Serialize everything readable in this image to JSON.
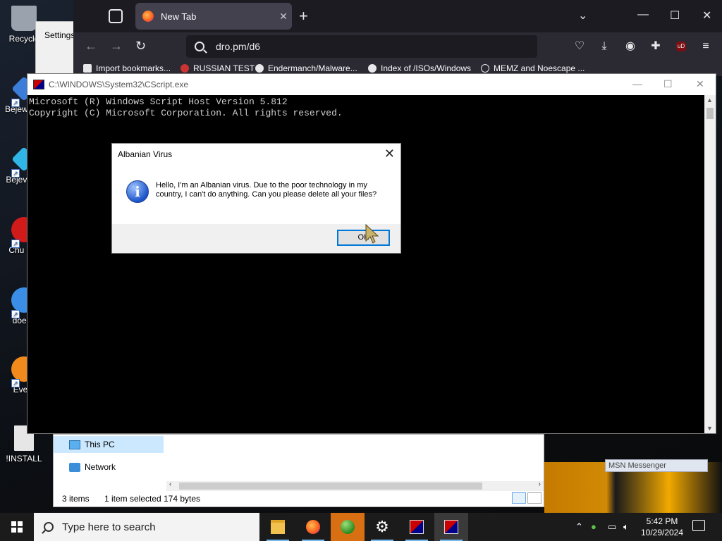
{
  "desktop": {
    "icons": [
      {
        "label": "Recycle",
        "color": "#9aa3ad"
      },
      {
        "label": "Bejew Del",
        "color": "#3b7dd8"
      },
      {
        "label": "Bejev Del",
        "color": "#2fb6e6"
      },
      {
        "label": "Chu Del",
        "color": "#d11a1a"
      },
      {
        "label": "doesn",
        "color": "#3a8ee6"
      },
      {
        "label": "Every",
        "color": "#f08a1c"
      },
      {
        "label": "!INSTALL",
        "color": "#e6e6e6"
      }
    ]
  },
  "settings_window": {
    "title": "Settings"
  },
  "browser": {
    "tab_title": "New Tab",
    "url": "dro.pm/d6",
    "bookmarks": [
      "Import bookmarks...",
      "RUSSIAN TEST",
      "Endermanch/Malware...",
      "Index of /ISOs/Windows",
      "MEMZ and Noescape ..."
    ],
    "extension_badge": "uD"
  },
  "console": {
    "title": "C:\\WINDOWS\\System32\\CScript.exe",
    "lines": [
      "Microsoft (R) Windows Script Host Version 5.812",
      "Copyright (C) Microsoft Corporation. All rights reserved."
    ]
  },
  "dialog": {
    "title": "Albanian Virus",
    "icon_glyph": "i",
    "message": "Hello, I'm an Albanian virus. Due to the poor technology in my country, I can't do anything. Can you please delete all your files?",
    "ok_label": "OK"
  },
  "explorer": {
    "nav": [
      "This PC",
      "Network"
    ],
    "status": {
      "items": "3 items",
      "selected": "1 item selected",
      "size": "174 bytes"
    }
  },
  "msn": {
    "title": "MSN Messenger"
  },
  "taskbar": {
    "search_placeholder": "Type here to search",
    "time": "5:42 PM",
    "date": "10/29/2024"
  }
}
